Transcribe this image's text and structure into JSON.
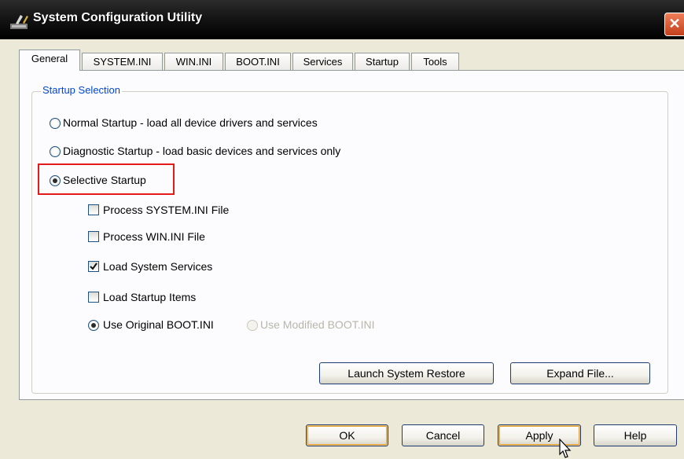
{
  "window": {
    "title": "System Configuration Utility",
    "close_glyph": "✕"
  },
  "tabs": [
    {
      "label": "General",
      "active": true
    },
    {
      "label": "SYSTEM.INI",
      "active": false
    },
    {
      "label": "WIN.INI",
      "active": false
    },
    {
      "label": "BOOT.INI",
      "active": false
    },
    {
      "label": "Services",
      "active": false
    },
    {
      "label": "Startup",
      "active": false
    },
    {
      "label": "Tools",
      "active": false
    }
  ],
  "startup_selection": {
    "legend": "Startup Selection",
    "options": [
      {
        "label": "Normal Startup - load all device drivers and services",
        "selected": false
      },
      {
        "label": "Diagnostic Startup - load basic devices and services only",
        "selected": false
      },
      {
        "label": "Selective Startup",
        "selected": true
      }
    ],
    "checkboxes": [
      {
        "label": "Process SYSTEM.INI File",
        "checked": false
      },
      {
        "label": "Process WIN.INI File",
        "checked": false
      },
      {
        "label": "Load System Services",
        "checked": true
      },
      {
        "label": "Load Startup Items",
        "checked": false
      }
    ],
    "boot_options": [
      {
        "label": "Use Original BOOT.INI",
        "selected": true,
        "enabled": true
      },
      {
        "label": "Use Modified BOOT.INI",
        "selected": false,
        "enabled": false
      }
    ]
  },
  "panel_buttons": {
    "launch_restore": "Launch System Restore",
    "expand_file": "Expand File..."
  },
  "dialog_buttons": {
    "ok": "OK",
    "cancel": "Cancel",
    "apply": "Apply",
    "help": "Help"
  },
  "colors": {
    "highlight_box": "#e31a1a",
    "legend_text": "#0046d5",
    "check_mark": "#21a121"
  }
}
